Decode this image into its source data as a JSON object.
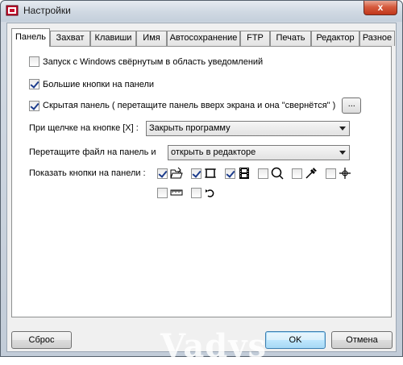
{
  "window": {
    "title": "Настройки",
    "close_label": "x"
  },
  "tabs": [
    {
      "label": "Панель",
      "active": true
    },
    {
      "label": "Захват"
    },
    {
      "label": "Клавиши"
    },
    {
      "label": "Имя"
    },
    {
      "label": "Автосохранение"
    },
    {
      "label": "FTP"
    },
    {
      "label": "Печать"
    },
    {
      "label": "Редактор"
    },
    {
      "label": "Разное"
    }
  ],
  "panel": {
    "opt_start_minimized": {
      "label": "Запуск с Windows свёрнутым в область уведомлений",
      "checked": false
    },
    "opt_big_buttons": {
      "label": "Большие кнопки на панели",
      "checked": true
    },
    "opt_hidden_panel": {
      "label": "Скрытая панель ( перетащите панель вверх экрана и она \"свернётся\" )",
      "checked": true
    },
    "ellipsis_label": "...",
    "close_click": {
      "label": "При щелчке на кнопке [X] :",
      "value": "Закрыть программу"
    },
    "drag_file": {
      "label": "Перетащите файл на панель и",
      "value": "открыть в редакторе"
    },
    "toolbar_buttons": {
      "label": "Показать кнопки на панели :",
      "items": [
        {
          "icon": "folder-open-icon",
          "checked": true
        },
        {
          "icon": "crop-frame-icon",
          "checked": true
        },
        {
          "icon": "film-strip-icon",
          "checked": true
        },
        {
          "icon": "magnifier-icon",
          "checked": false
        },
        {
          "icon": "eyedropper-icon",
          "checked": false
        },
        {
          "icon": "crosshair-icon",
          "checked": false
        },
        {
          "icon": "ruler-icon",
          "checked": false
        },
        {
          "icon": "undo-arrow-icon",
          "checked": false
        }
      ]
    }
  },
  "buttons": {
    "reset": "Сброс",
    "ok": "OK",
    "cancel": "Отмена"
  },
  "watermark": "Vadys"
}
